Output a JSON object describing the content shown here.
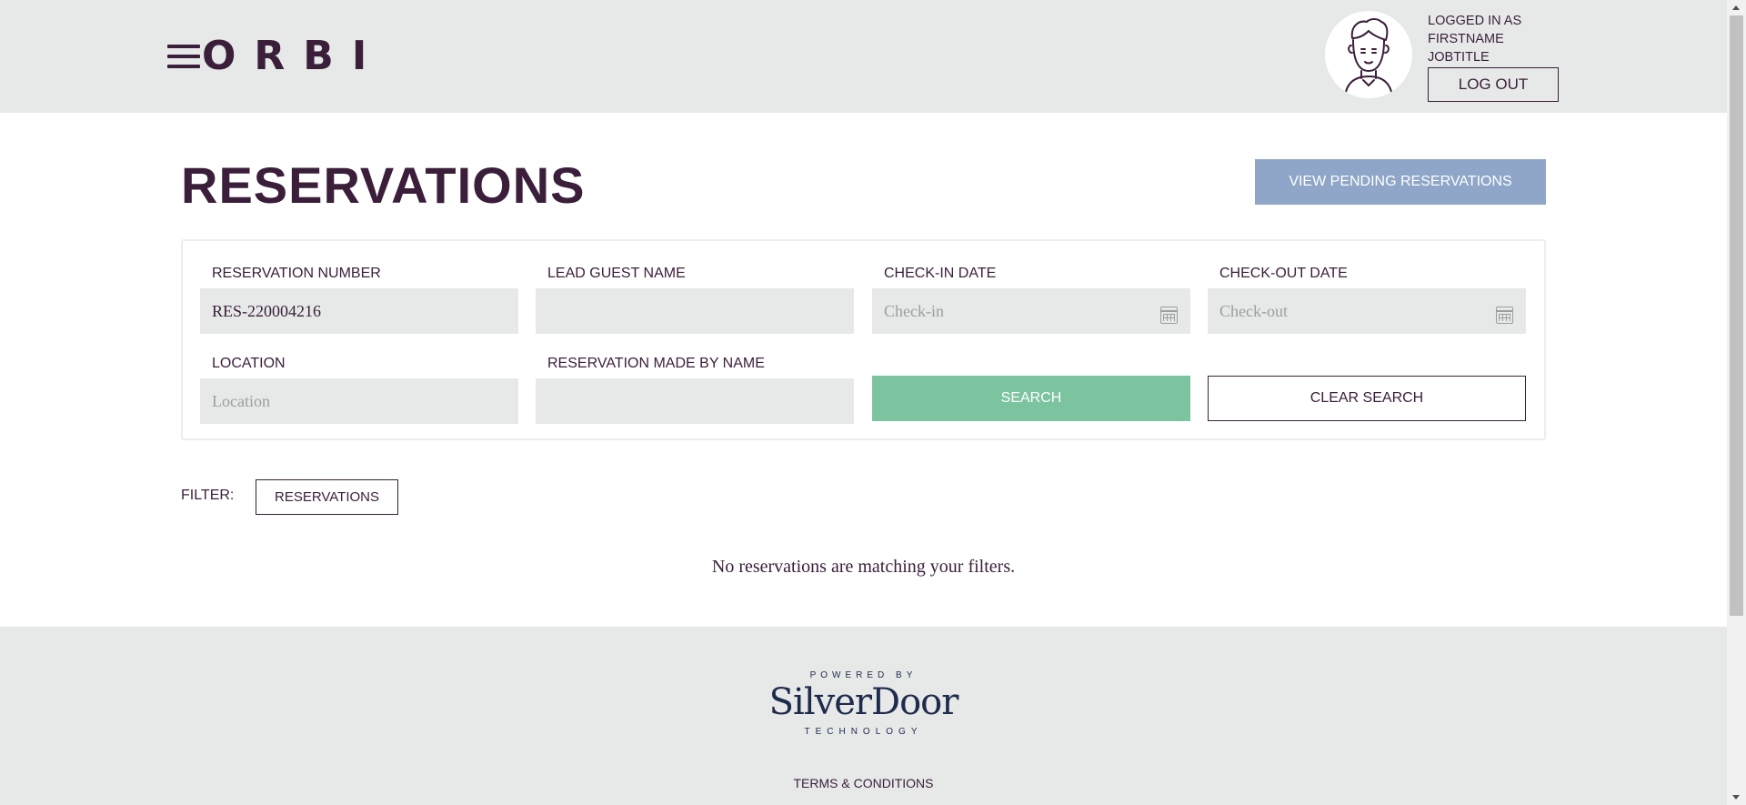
{
  "header": {
    "logo_text": "ORBI",
    "menu_icon": "hamburger-icon",
    "user": {
      "logged_in_as_label": "LOGGED IN AS",
      "first_name": "FIRSTNAME",
      "job_title": "JOBTITLE",
      "avatar_icon": "user-avatar-icon",
      "logout_label": "LOG OUT"
    }
  },
  "main": {
    "title": "RESERVATIONS",
    "pending_button_label": "VIEW PENDING RESERVATIONS",
    "search": {
      "reservation_number": {
        "label": "RESERVATION NUMBER",
        "value": "RES-220004216",
        "placeholder": ""
      },
      "lead_guest_name": {
        "label": "LEAD GUEST NAME",
        "value": "",
        "placeholder": ""
      },
      "check_in_date": {
        "label": "CHECK-IN DATE",
        "value": "",
        "placeholder": "Check-in",
        "icon": "calendar-icon"
      },
      "check_out_date": {
        "label": "CHECK-OUT DATE",
        "value": "",
        "placeholder": "Check-out",
        "icon": "calendar-icon"
      },
      "location": {
        "label": "LOCATION",
        "value": "",
        "placeholder": "Location"
      },
      "made_by_name": {
        "label": "RESERVATION MADE BY NAME",
        "value": "",
        "placeholder": ""
      },
      "search_label": "SEARCH",
      "clear_label": "CLEAR SEARCH"
    },
    "filter": {
      "label": "FILTER:",
      "chip_label": "RESERVATIONS"
    },
    "empty_message": "No reservations are matching your filters."
  },
  "footer": {
    "powered_by": "POWERED BY",
    "brand": "SilverDoor",
    "brand_sub": "TECHNOLOGY",
    "terms_label": "TERMS & CONDITIONS"
  },
  "colors": {
    "primary_text": "#3a1e3a",
    "header_bg": "#e6e9e8",
    "pending_button": "#8fa6c8",
    "search_button": "#7cc4a0",
    "footer_brand": "#1f2b4d"
  }
}
